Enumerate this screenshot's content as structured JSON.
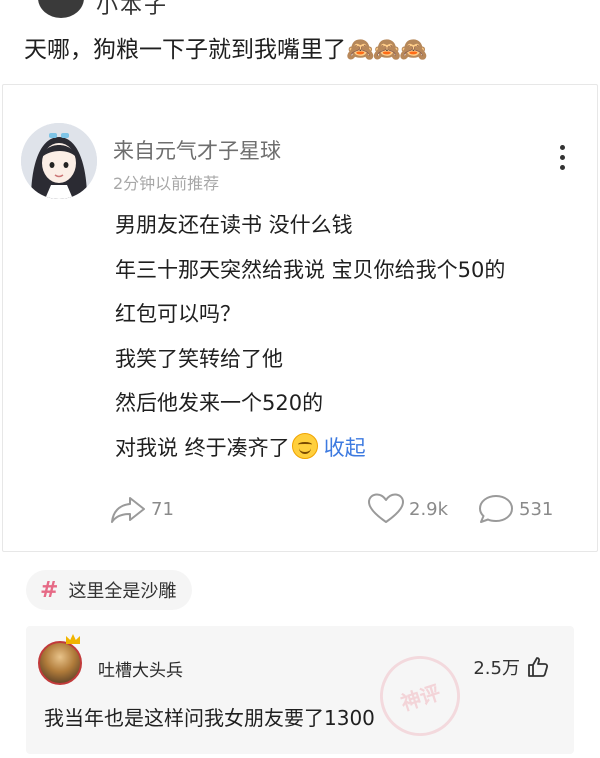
{
  "header": {
    "partial_name": "小本子"
  },
  "headline": {
    "text": "天哪，狗粮一下子就到我嘴里了",
    "emojis": "🙈🙈🙈"
  },
  "post": {
    "author": "来自元气才子星球",
    "time": "2分钟以前推荐",
    "lines": [
      "男朋友还在读书 没什么钱",
      "年三十那天突然给我说 宝贝你给我个50的",
      "红包可以吗？",
      "我笑了笑转给了他",
      "然后他发来一个520的",
      "对我说 终于凑齐了"
    ],
    "collapse_label": "收起",
    "emoji": "smile-emoji",
    "share_count": "71",
    "like_count": "2.9k",
    "comment_count": "531"
  },
  "tag": {
    "hash": "#",
    "label": "这里全是沙雕"
  },
  "hot_comment": {
    "user": "吐槽大头兵",
    "likes": "2.5万",
    "text": "我当年也是这样问我女朋友要了1300",
    "stamp": "神评"
  },
  "colors": {
    "link": "#3d7ae0",
    "tag_hash": "#e66a86",
    "muted": "#8a8a8a"
  }
}
